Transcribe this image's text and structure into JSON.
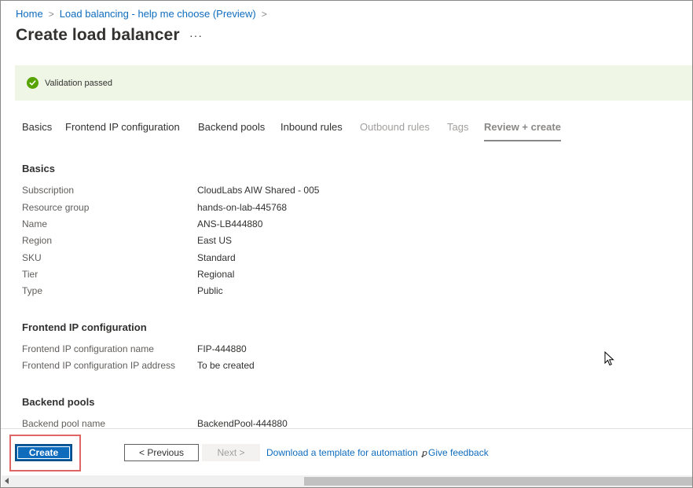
{
  "breadcrumb": {
    "items": [
      "Home",
      "Load balancing - help me choose (Preview)"
    ],
    "separator": ">"
  },
  "page": {
    "title": "Create load balancer",
    "more_label": "···"
  },
  "banner": {
    "text": "Validation passed",
    "status_color": "#57a300"
  },
  "tabs": [
    {
      "label": "Basics",
      "state": "enabled"
    },
    {
      "label": "Frontend IP configuration",
      "state": "enabled"
    },
    {
      "label": "Backend pools",
      "state": "enabled"
    },
    {
      "label": "Inbound rules",
      "state": "enabled"
    },
    {
      "label": "Outbound rules",
      "state": "disabled"
    },
    {
      "label": "Tags",
      "state": "disabled"
    },
    {
      "label": "Review + create",
      "state": "active"
    }
  ],
  "sections": {
    "basics": {
      "title": "Basics",
      "rows": [
        {
          "key": "Subscription",
          "value": "CloudLabs AIW Shared - 005"
        },
        {
          "key": "Resource group",
          "value": "hands-on-lab-445768"
        },
        {
          "key": "Name",
          "value": "ANS-LB444880"
        },
        {
          "key": "Region",
          "value": "East US"
        },
        {
          "key": "SKU",
          "value": "Standard"
        },
        {
          "key": "Tier",
          "value": "Regional"
        },
        {
          "key": "Type",
          "value": "Public"
        }
      ]
    },
    "frontend": {
      "title": "Frontend IP configuration",
      "rows": [
        {
          "key": "Frontend IP configuration name",
          "value": "FIP-444880"
        },
        {
          "key": "Frontend IP configuration IP address",
          "value": "To be created"
        }
      ]
    },
    "backend": {
      "title": "Backend pools",
      "rows": [
        {
          "key": "Backend pool name",
          "value": "BackendPool-444880"
        }
      ]
    }
  },
  "footer": {
    "create_label": "Create",
    "previous_label": "< Previous",
    "next_label": "Next >",
    "download_label": "Download a template for automation",
    "feedback_icon": "ꝑ",
    "feedback_label": "Give feedback"
  },
  "colors": {
    "accent": "#0f6cbd",
    "highlight": "#e06666"
  }
}
